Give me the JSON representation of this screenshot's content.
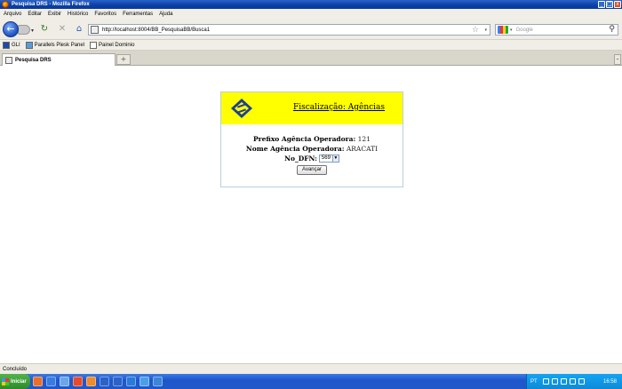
{
  "window": {
    "title": "Pesquisa DRS - Mozilla Firefox",
    "minimize": "_",
    "maximize": "□",
    "close": "x"
  },
  "menu": [
    "Arquivo",
    "Editar",
    "Exibir",
    "Histórico",
    "Favoritos",
    "Ferramentas",
    "Ajuda"
  ],
  "navbar": {
    "url": "http://localhost:8004/BB_PesquisaBB/Busca1",
    "search_placeholder": "Google"
  },
  "bookmarks": [
    "GLI",
    "Parallels Plesk Panel",
    "Painel Dominio"
  ],
  "tabs": [
    {
      "label": "Pesquisa DRS"
    }
  ],
  "page": {
    "header_title": "Fiscalização: Agências",
    "prefixo_label": "Prefixo Agência Operadora:",
    "prefixo_value": "121",
    "nome_label": "Nome Agência Operadora:",
    "nome_value": "ARACATI",
    "dfn_label": "No_DFN:",
    "dfn_value": "569",
    "button": "Avançar"
  },
  "status": "Concluído",
  "taskbar": {
    "start": "Iniciar",
    "lang": "PT",
    "clock": "16:58"
  },
  "colors": {
    "header_bg": "#ffff00",
    "bb_blue": "#1c3f94",
    "card_border": "#b9d0de"
  }
}
